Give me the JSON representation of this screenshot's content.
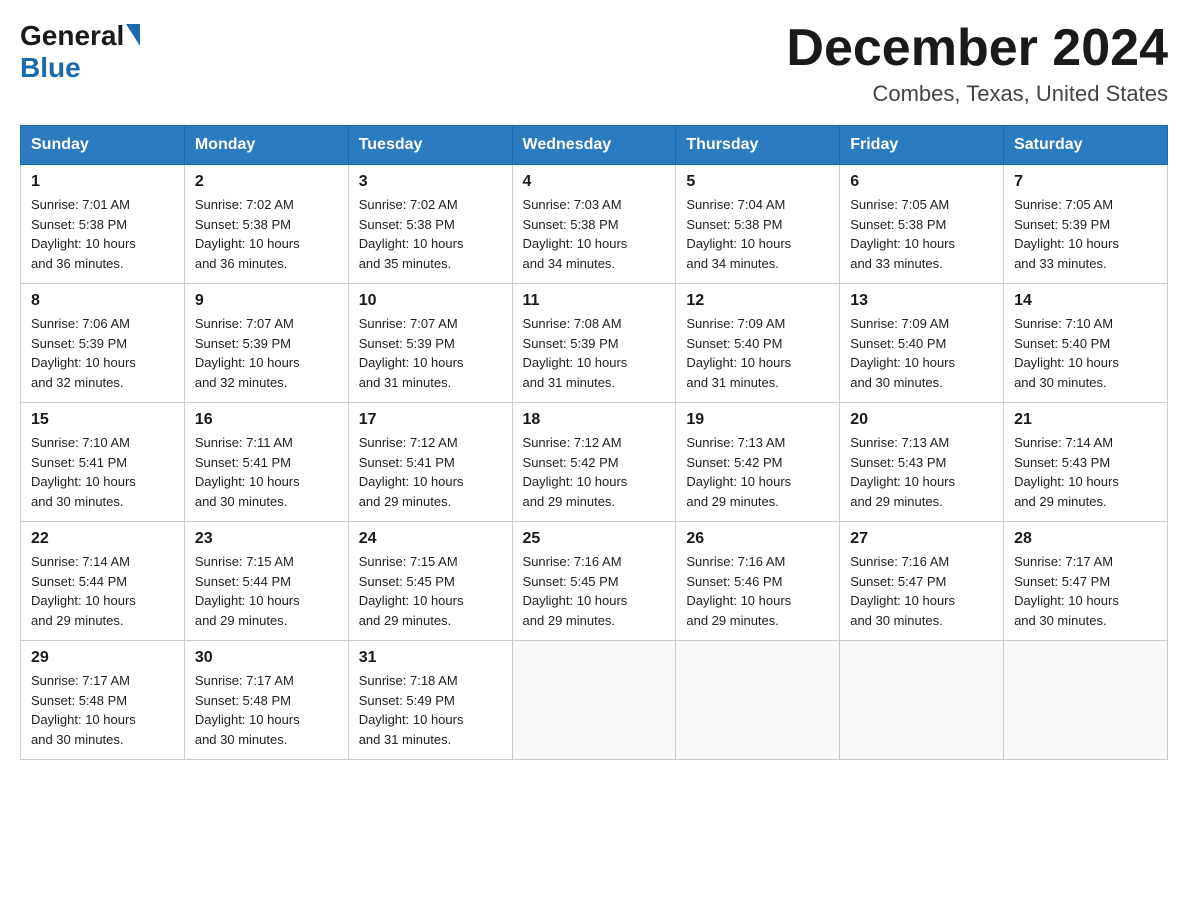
{
  "logo": {
    "general": "General",
    "blue": "Blue"
  },
  "title": {
    "month_year": "December 2024",
    "location": "Combes, Texas, United States"
  },
  "weekdays": [
    "Sunday",
    "Monday",
    "Tuesday",
    "Wednesday",
    "Thursday",
    "Friday",
    "Saturday"
  ],
  "weeks": [
    [
      {
        "day": "1",
        "sunrise": "7:01 AM",
        "sunset": "5:38 PM",
        "daylight": "10 hours and 36 minutes."
      },
      {
        "day": "2",
        "sunrise": "7:02 AM",
        "sunset": "5:38 PM",
        "daylight": "10 hours and 36 minutes."
      },
      {
        "day": "3",
        "sunrise": "7:02 AM",
        "sunset": "5:38 PM",
        "daylight": "10 hours and 35 minutes."
      },
      {
        "day": "4",
        "sunrise": "7:03 AM",
        "sunset": "5:38 PM",
        "daylight": "10 hours and 34 minutes."
      },
      {
        "day": "5",
        "sunrise": "7:04 AM",
        "sunset": "5:38 PM",
        "daylight": "10 hours and 34 minutes."
      },
      {
        "day": "6",
        "sunrise": "7:05 AM",
        "sunset": "5:38 PM",
        "daylight": "10 hours and 33 minutes."
      },
      {
        "day": "7",
        "sunrise": "7:05 AM",
        "sunset": "5:39 PM",
        "daylight": "10 hours and 33 minutes."
      }
    ],
    [
      {
        "day": "8",
        "sunrise": "7:06 AM",
        "sunset": "5:39 PM",
        "daylight": "10 hours and 32 minutes."
      },
      {
        "day": "9",
        "sunrise": "7:07 AM",
        "sunset": "5:39 PM",
        "daylight": "10 hours and 32 minutes."
      },
      {
        "day": "10",
        "sunrise": "7:07 AM",
        "sunset": "5:39 PM",
        "daylight": "10 hours and 31 minutes."
      },
      {
        "day": "11",
        "sunrise": "7:08 AM",
        "sunset": "5:39 PM",
        "daylight": "10 hours and 31 minutes."
      },
      {
        "day": "12",
        "sunrise": "7:09 AM",
        "sunset": "5:40 PM",
        "daylight": "10 hours and 31 minutes."
      },
      {
        "day": "13",
        "sunrise": "7:09 AM",
        "sunset": "5:40 PM",
        "daylight": "10 hours and 30 minutes."
      },
      {
        "day": "14",
        "sunrise": "7:10 AM",
        "sunset": "5:40 PM",
        "daylight": "10 hours and 30 minutes."
      }
    ],
    [
      {
        "day": "15",
        "sunrise": "7:10 AM",
        "sunset": "5:41 PM",
        "daylight": "10 hours and 30 minutes."
      },
      {
        "day": "16",
        "sunrise": "7:11 AM",
        "sunset": "5:41 PM",
        "daylight": "10 hours and 30 minutes."
      },
      {
        "day": "17",
        "sunrise": "7:12 AM",
        "sunset": "5:41 PM",
        "daylight": "10 hours and 29 minutes."
      },
      {
        "day": "18",
        "sunrise": "7:12 AM",
        "sunset": "5:42 PM",
        "daylight": "10 hours and 29 minutes."
      },
      {
        "day": "19",
        "sunrise": "7:13 AM",
        "sunset": "5:42 PM",
        "daylight": "10 hours and 29 minutes."
      },
      {
        "day": "20",
        "sunrise": "7:13 AM",
        "sunset": "5:43 PM",
        "daylight": "10 hours and 29 minutes."
      },
      {
        "day": "21",
        "sunrise": "7:14 AM",
        "sunset": "5:43 PM",
        "daylight": "10 hours and 29 minutes."
      }
    ],
    [
      {
        "day": "22",
        "sunrise": "7:14 AM",
        "sunset": "5:44 PM",
        "daylight": "10 hours and 29 minutes."
      },
      {
        "day": "23",
        "sunrise": "7:15 AM",
        "sunset": "5:44 PM",
        "daylight": "10 hours and 29 minutes."
      },
      {
        "day": "24",
        "sunrise": "7:15 AM",
        "sunset": "5:45 PM",
        "daylight": "10 hours and 29 minutes."
      },
      {
        "day": "25",
        "sunrise": "7:16 AM",
        "sunset": "5:45 PM",
        "daylight": "10 hours and 29 minutes."
      },
      {
        "day": "26",
        "sunrise": "7:16 AM",
        "sunset": "5:46 PM",
        "daylight": "10 hours and 29 minutes."
      },
      {
        "day": "27",
        "sunrise": "7:16 AM",
        "sunset": "5:47 PM",
        "daylight": "10 hours and 30 minutes."
      },
      {
        "day": "28",
        "sunrise": "7:17 AM",
        "sunset": "5:47 PM",
        "daylight": "10 hours and 30 minutes."
      }
    ],
    [
      {
        "day": "29",
        "sunrise": "7:17 AM",
        "sunset": "5:48 PM",
        "daylight": "10 hours and 30 minutes."
      },
      {
        "day": "30",
        "sunrise": "7:17 AM",
        "sunset": "5:48 PM",
        "daylight": "10 hours and 30 minutes."
      },
      {
        "day": "31",
        "sunrise": "7:18 AM",
        "sunset": "5:49 PM",
        "daylight": "10 hours and 31 minutes."
      },
      null,
      null,
      null,
      null
    ]
  ],
  "labels": {
    "sunrise": "Sunrise: ",
    "sunset": "Sunset: ",
    "daylight": "Daylight: "
  }
}
